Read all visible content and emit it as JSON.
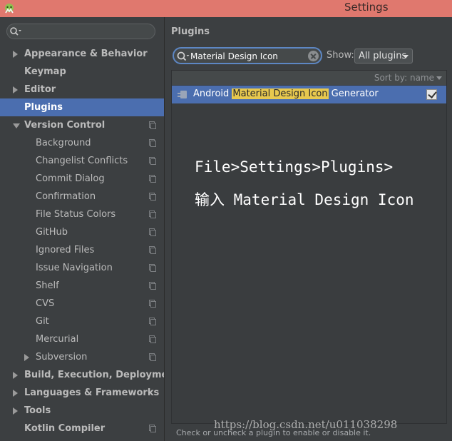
{
  "window": {
    "title": "Settings"
  },
  "sidebar": {
    "search": {
      "value": "",
      "placeholder": ""
    },
    "items": [
      {
        "label": "Appearance & Behavior",
        "level": 0,
        "expander": "collapsed",
        "project_icon": false,
        "selected": false
      },
      {
        "label": "Keymap",
        "level": 0,
        "expander": "none",
        "project_icon": false,
        "selected": false
      },
      {
        "label": "Editor",
        "level": 0,
        "expander": "collapsed",
        "project_icon": false,
        "selected": false
      },
      {
        "label": "Plugins",
        "level": 0,
        "expander": "none",
        "project_icon": false,
        "selected": true
      },
      {
        "label": "Version Control",
        "level": 0,
        "expander": "expanded",
        "project_icon": true,
        "selected": false
      },
      {
        "label": "Background",
        "level": 1,
        "expander": "none",
        "project_icon": true,
        "selected": false
      },
      {
        "label": "Changelist Conflicts",
        "level": 1,
        "expander": "none",
        "project_icon": true,
        "selected": false
      },
      {
        "label": "Commit Dialog",
        "level": 1,
        "expander": "none",
        "project_icon": true,
        "selected": false
      },
      {
        "label": "Confirmation",
        "level": 1,
        "expander": "none",
        "project_icon": true,
        "selected": false
      },
      {
        "label": "File Status Colors",
        "level": 1,
        "expander": "none",
        "project_icon": true,
        "selected": false
      },
      {
        "label": "GitHub",
        "level": 1,
        "expander": "none",
        "project_icon": true,
        "selected": false
      },
      {
        "label": "Ignored Files",
        "level": 1,
        "expander": "none",
        "project_icon": true,
        "selected": false
      },
      {
        "label": "Issue Navigation",
        "level": 1,
        "expander": "none",
        "project_icon": true,
        "selected": false
      },
      {
        "label": "Shelf",
        "level": 1,
        "expander": "none",
        "project_icon": true,
        "selected": false
      },
      {
        "label": "CVS",
        "level": 1,
        "expander": "none",
        "project_icon": true,
        "selected": false
      },
      {
        "label": "Git",
        "level": 1,
        "expander": "none",
        "project_icon": true,
        "selected": false
      },
      {
        "label": "Mercurial",
        "level": 1,
        "expander": "none",
        "project_icon": true,
        "selected": false
      },
      {
        "label": "Subversion",
        "level": 1,
        "expander": "collapsed",
        "project_icon": true,
        "selected": false
      },
      {
        "label": "Build, Execution, Deployment",
        "level": 0,
        "expander": "collapsed",
        "project_icon": false,
        "selected": false
      },
      {
        "label": "Languages & Frameworks",
        "level": 0,
        "expander": "collapsed",
        "project_icon": false,
        "selected": false
      },
      {
        "label": "Tools",
        "level": 0,
        "expander": "collapsed",
        "project_icon": false,
        "selected": false
      },
      {
        "label": "Kotlin Compiler",
        "level": 0,
        "expander": "none",
        "project_icon": true,
        "selected": false
      }
    ]
  },
  "main": {
    "title": "Plugins",
    "search": {
      "value": "Material Design Icon"
    },
    "show": {
      "label": "Show:",
      "selected": "All plugins"
    },
    "sort": {
      "label": "Sort by: name"
    },
    "plugins": [
      {
        "prefix": "Android ",
        "match": "Material Design Icon",
        "suffix": " Generator",
        "enabled": true,
        "selected": true
      }
    ],
    "annotation": {
      "line1": "File>Settings>Plugins>",
      "line2": "输入 Material Design Icon"
    },
    "hint": "Check or uncheck a plugin to enable or disable it.",
    "watermark": "https://blog.csdn.net/u011038298"
  },
  "colors": {
    "title_bar": "#e0786e",
    "background": "#3c3f41",
    "selection": "#4b6eaf",
    "search_highlight": "#e7c84e",
    "focus_border": "#5d87c4"
  },
  "icons": {
    "app": "android-studio-icon",
    "search": "search-icon",
    "clear": "clear-search-icon",
    "plugin": "plugin-icon",
    "project": "project-scope-icon"
  }
}
